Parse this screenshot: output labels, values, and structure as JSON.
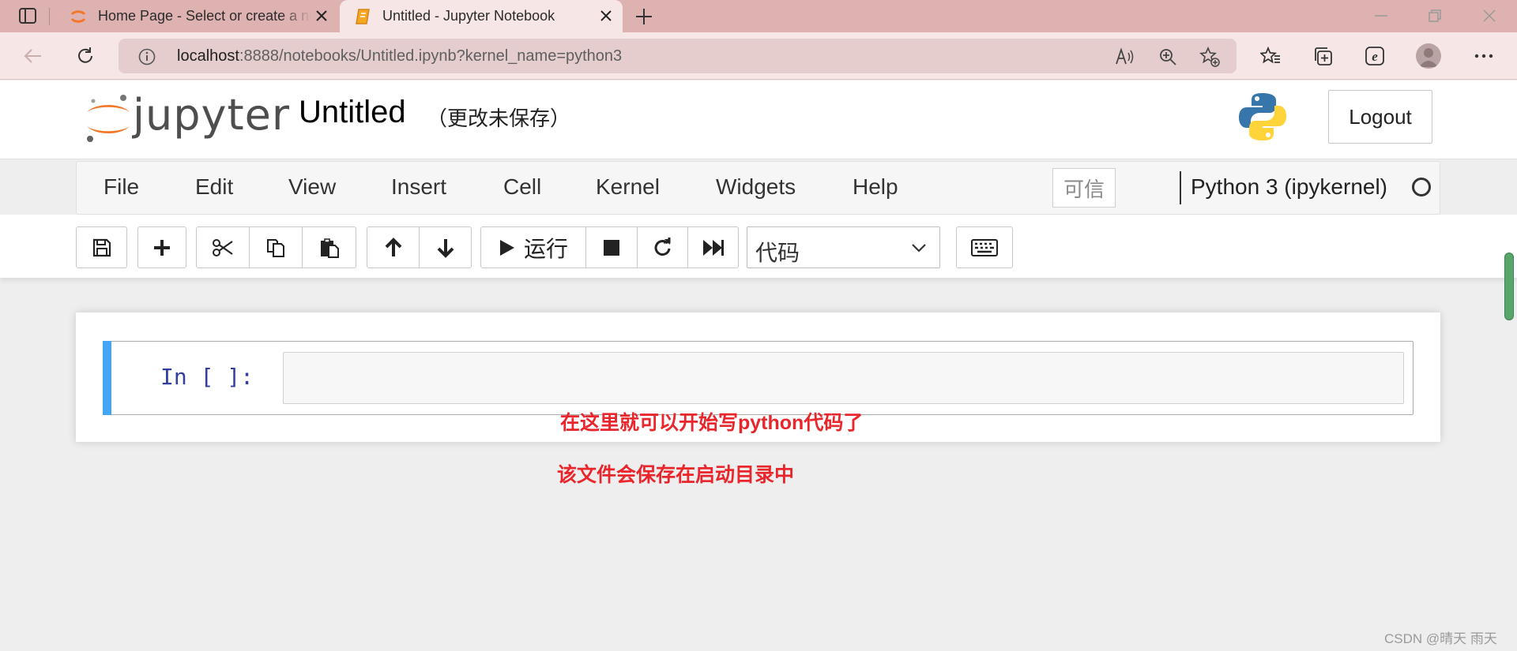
{
  "browser": {
    "tabs": [
      {
        "title": "Home Page - Select or create a notebook",
        "active": false
      },
      {
        "title": "Untitled - Jupyter Notebook",
        "active": true
      }
    ],
    "url_host": "localhost",
    "url_rest": ":8888/notebooks/Untitled.ipynb?kernel_name=python3"
  },
  "header": {
    "logo_text": "jupyter",
    "notebook_name": "Untitled",
    "save_status": "（更改未保存）",
    "logout_label": "Logout"
  },
  "menubar": {
    "items": [
      "File",
      "Edit",
      "View",
      "Insert",
      "Cell",
      "Kernel",
      "Widgets",
      "Help"
    ],
    "trusted_label": "可信",
    "kernel_name": "Python 3 (ipykernel)"
  },
  "toolbar": {
    "run_label": "运行",
    "cell_type_value": "代码"
  },
  "cell": {
    "prompt": "In [ ]:"
  },
  "annotations": {
    "line1": "在这里就可以开始写python代码了",
    "line2": "该文件会保存在启动目录中"
  },
  "watermark": "CSDN @晴天 雨天",
  "colors": {
    "tab_strip": "#dfb2b2",
    "active_tab": "#f6e6e6",
    "cell_selected_bar": "#42a5f5",
    "annotation": "#e8262b",
    "prompt": "#303f9f",
    "jupyter_orange": "#f37726"
  }
}
